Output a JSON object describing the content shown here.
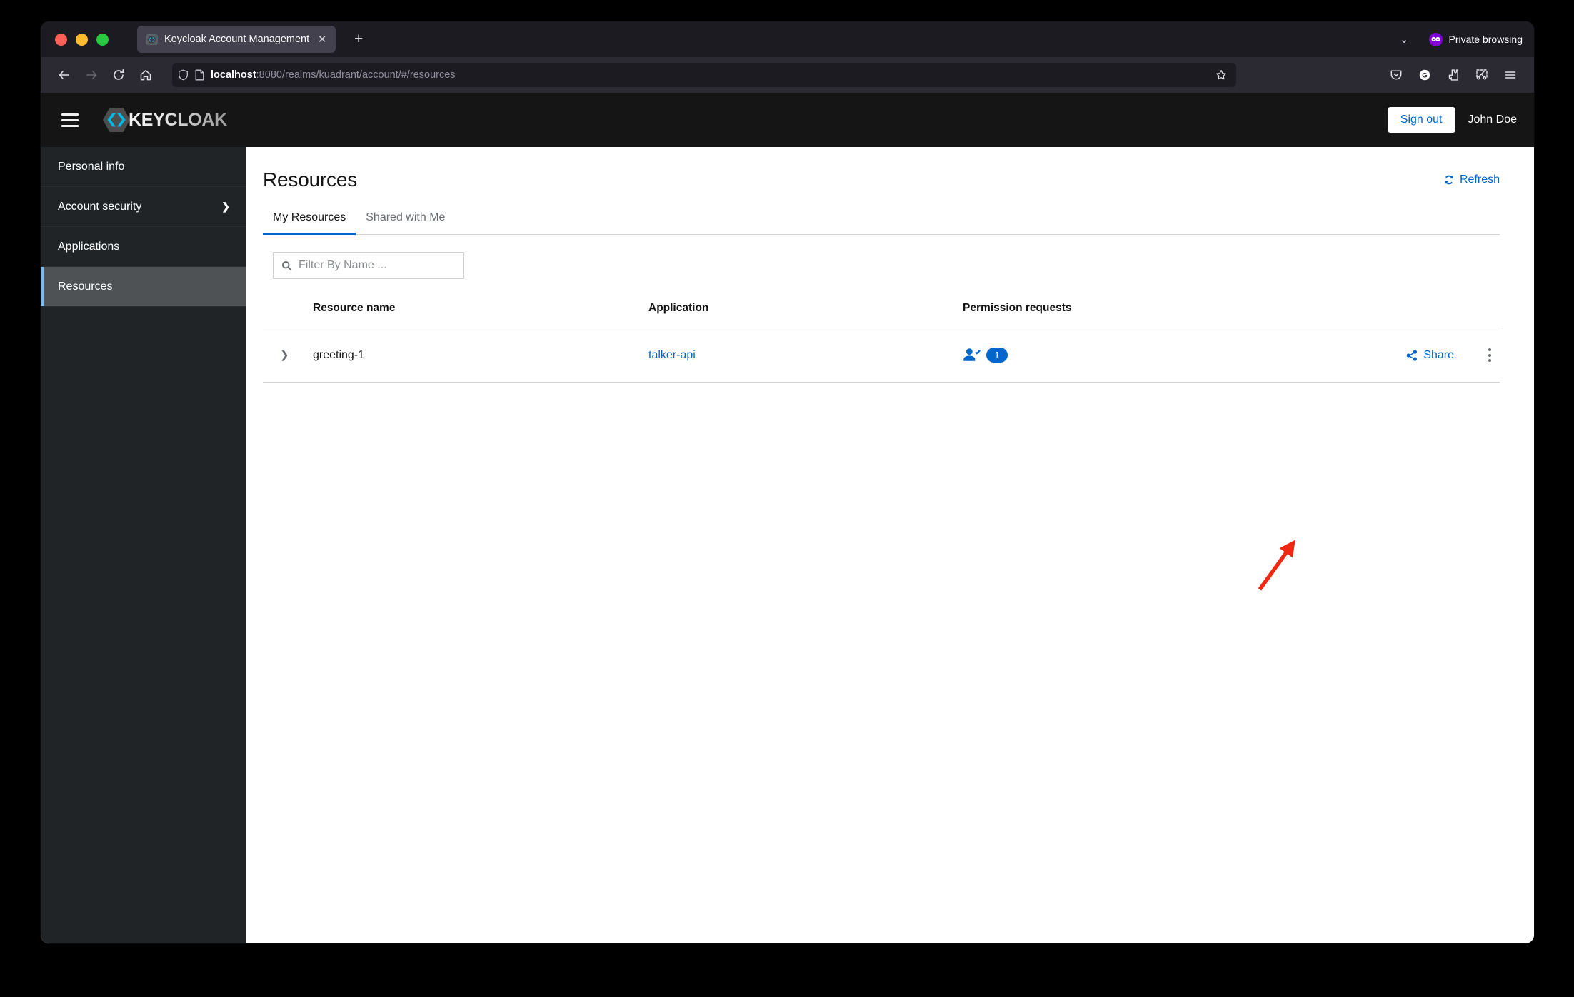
{
  "browser": {
    "tab": {
      "title": "Keycloak Account Management",
      "close_label": "✕",
      "favicon_name": "keycloak-favicon"
    },
    "new_tab_label": "+",
    "tabstrip_chevron_label": "⌄",
    "private_browsing_label": "Private browsing",
    "url": {
      "host": "localhost",
      "path": ":8080/realms/kuadrant/account/#/resources",
      "full": "localhost:8080/realms/kuadrant/account/#/resources"
    },
    "toolbar_icons": {
      "back": "back-arrow-icon",
      "forward": "forward-arrow-icon",
      "reload": "reload-icon",
      "home": "home-icon",
      "shield": "shield-icon",
      "page": "page-icon",
      "bookmark_star": "star-icon",
      "pocket": "pocket-icon",
      "account": "account-icon",
      "extension": "extension-icon",
      "screenshot": "screenshot-icon",
      "app_menu": "hamburger-menu-icon"
    }
  },
  "header": {
    "brand": "KEYCLOAK",
    "sign_out_label": "Sign out",
    "username": "John Doe"
  },
  "sidebar": {
    "items": [
      {
        "label": "Personal info",
        "active": false,
        "has_caret": false
      },
      {
        "label": "Account security",
        "active": false,
        "has_caret": true,
        "caret": "❯"
      },
      {
        "label": "Applications",
        "active": false,
        "has_caret": false
      },
      {
        "label": "Resources",
        "active": true,
        "has_caret": false
      }
    ]
  },
  "main": {
    "page_title": "Resources",
    "refresh_label": "Refresh",
    "tabs": [
      {
        "label": "My Resources",
        "active": true
      },
      {
        "label": "Shared with Me",
        "active": false
      }
    ],
    "filter": {
      "placeholder": "Filter By Name ...",
      "value": ""
    },
    "table": {
      "columns": [
        "Resource name",
        "Application",
        "Permission requests"
      ],
      "rows": [
        {
          "toggle": "❯",
          "resource_name": "greeting-1",
          "application": "talker-api",
          "permission_requests_count": "1",
          "share_label": "Share",
          "kebab_label": "⋮"
        }
      ]
    }
  },
  "annotation": {
    "arrow_color": "#f02711",
    "points_to": "permission-requests-badge"
  },
  "colors": {
    "accent_blue": "#0066cc",
    "badge_blue": "#0066cc",
    "sidebar_bg": "#212427",
    "sidebar_active_bg": "#4f5255",
    "sidebar_active_border": "#73bcf7",
    "header_bg": "#151515",
    "browser_chrome": "#2b2a33",
    "private_purple": "#8000d7"
  }
}
